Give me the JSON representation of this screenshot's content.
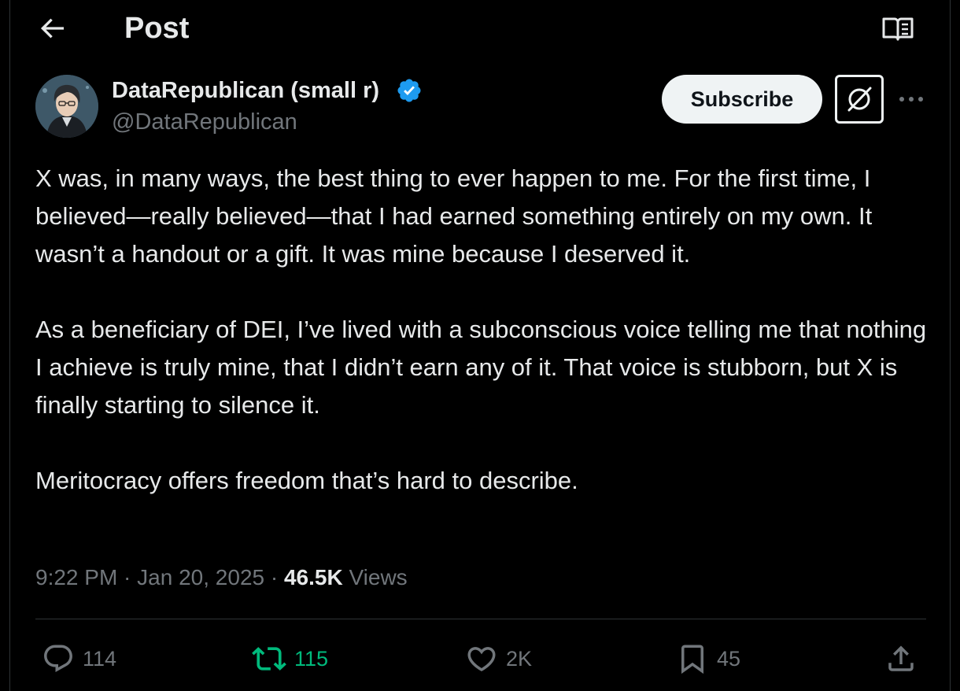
{
  "header": {
    "title": "Post",
    "back_icon": "arrow-left-icon",
    "reader_icon": "book-open-icon"
  },
  "author": {
    "name": "DataRepublican (small r)",
    "handle": "@DataRepublican",
    "verified_icon": "verified-badge-icon",
    "avatar_icon": "avatar"
  },
  "actions_top": {
    "subscribe_label": "Subscribe",
    "grok_icon": "grok-icon",
    "more_icon": "more-horizontal-icon"
  },
  "post": {
    "paragraphs": [
      "X was, in many ways, the best thing to ever happen to me. For the first time, I believed—really believed—that I had earned something entirely on my own. It wasn’t a handout or a gift. It was mine because I deserved it.",
      "As a beneficiary of DEI, I’ve lived with a subconscious voice telling me that nothing I achieve is truly mine, that I didn’t earn any of it. That voice is stubborn, but X is finally starting to silence it.",
      "Meritocracy offers freedom that’s hard to describe."
    ],
    "time": "9:22 PM",
    "separator": " · ",
    "date": "Jan 20, 2025",
    "views_count": "46.5K",
    "views_label": "Views"
  },
  "engagement": {
    "replies": "114",
    "reposts": "115",
    "likes": "2K",
    "bookmarks": "45",
    "icons": [
      "reply-icon",
      "repost-icon",
      "like-icon",
      "bookmark-icon",
      "share-icon"
    ]
  },
  "colors": {
    "background": "#000000",
    "text_primary": "#e7e9ea",
    "text_secondary": "#71767b",
    "verified": "#1d9bf0",
    "repost_active": "#00ba7c",
    "divider": "#2f3336"
  }
}
